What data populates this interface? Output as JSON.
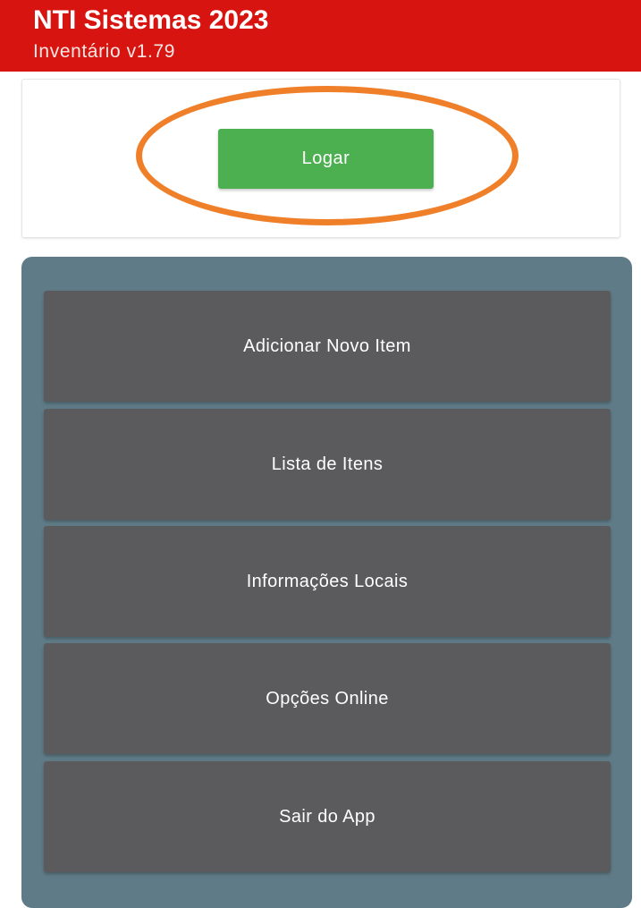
{
  "header": {
    "title": "NTI Sistemas 2023",
    "subtitle": "Inventário v1.79",
    "background_color": "#d7140f"
  },
  "login": {
    "button_label": "Logar",
    "button_color": "#4caf50",
    "highlight_color": "#f07f2a"
  },
  "menu": {
    "panel_color": "#5f7b87",
    "item_color": "#5b5b5d",
    "items": [
      {
        "label": "Adicionar Novo Item"
      },
      {
        "label": "Lista de Itens"
      },
      {
        "label": "Informações Locais"
      },
      {
        "label": "Opções Online"
      },
      {
        "label": "Sair do App"
      }
    ]
  }
}
